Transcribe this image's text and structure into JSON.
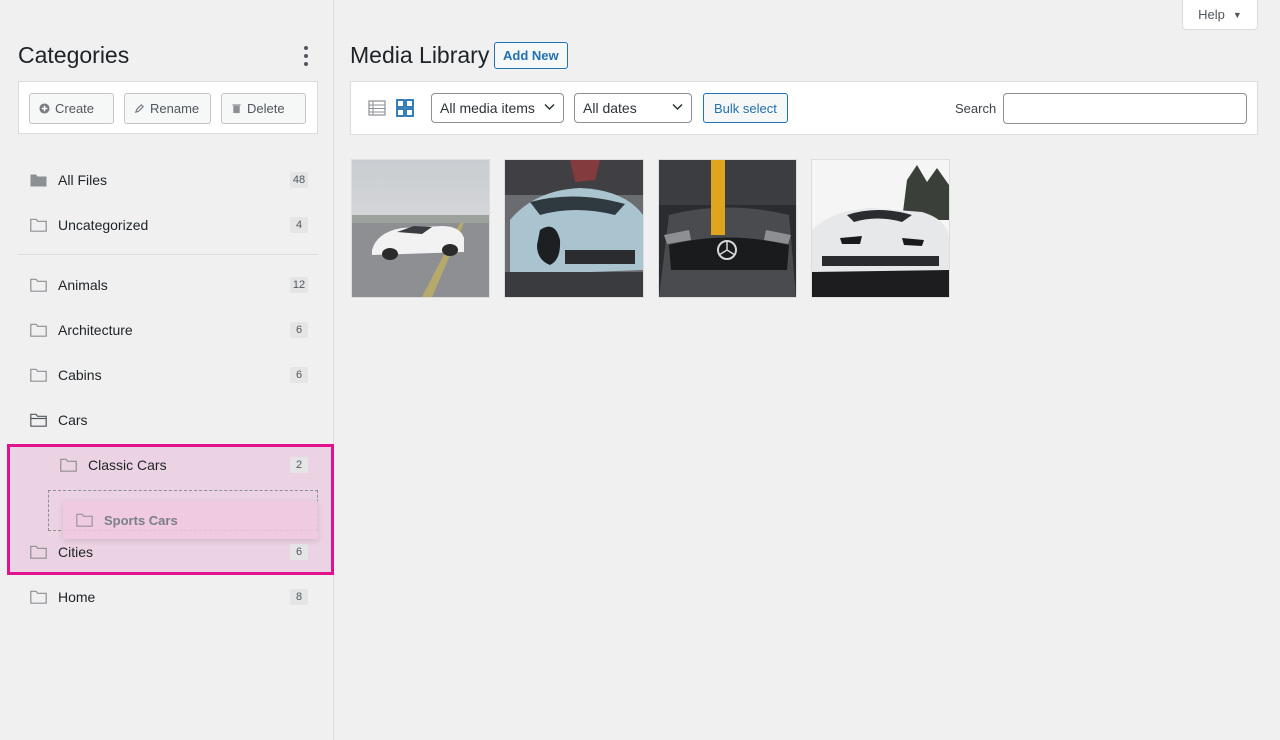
{
  "help": {
    "label": "Help"
  },
  "sidebar": {
    "title": "Categories",
    "toolbar": {
      "create": "Create",
      "rename": "Rename",
      "delete": "Delete"
    },
    "fixed_items": [
      {
        "label": "All Files",
        "count": "48"
      },
      {
        "label": "Uncategorized",
        "count": "4"
      }
    ],
    "items": [
      {
        "label": "Animals",
        "count": "12"
      },
      {
        "label": "Architecture",
        "count": "6"
      },
      {
        "label": "Cabins",
        "count": "6"
      },
      {
        "label": "Cars",
        "count": ""
      },
      {
        "label": "Classic Cars",
        "count": "2"
      },
      {
        "label": "Cities",
        "count": "6"
      },
      {
        "label": "Home",
        "count": "8"
      }
    ],
    "dragging": {
      "label": "Sports Cars"
    },
    "accent_color": "#e0138c"
  },
  "main": {
    "title": "Media Library",
    "add_new": "Add New",
    "filters": {
      "media_type": "All media items",
      "dates": "All dates",
      "bulk_select": "Bulk select",
      "search_label": "Search",
      "search_value": ""
    },
    "view_modes": [
      "list-view-icon",
      "grid-view-icon"
    ],
    "active_view": "grid",
    "thumbnails": [
      {
        "name": "white-lamborghini-road"
      },
      {
        "name": "bugatti-chiron-front"
      },
      {
        "name": "mercedes-amg-yellow-stripe"
      },
      {
        "name": "white-lamborghini-huracan"
      }
    ],
    "link_color": "#2271b1"
  }
}
